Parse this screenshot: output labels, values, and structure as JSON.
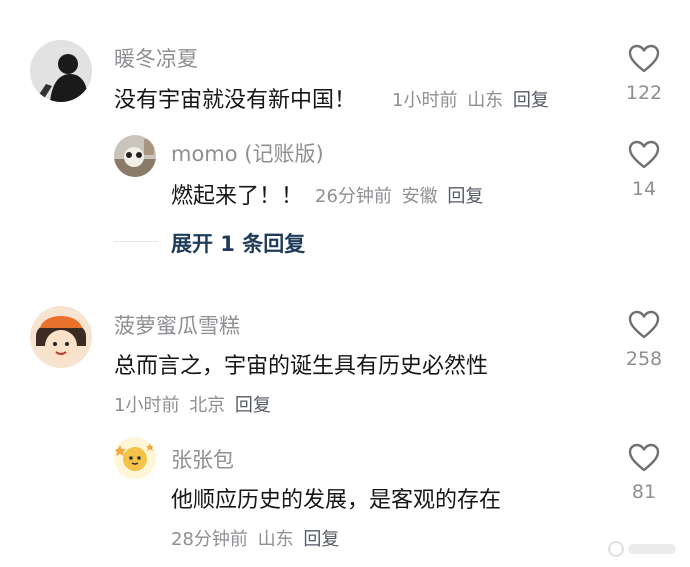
{
  "comments": [
    {
      "username": "暖冬凉夏",
      "text": "没有宇宙就没有新中国！",
      "time": "1小时前",
      "location": "山东",
      "reply_label": "回复",
      "likes": "122",
      "replies": [
        {
          "username": "momo (记账版)",
          "text": "燃起来了！！",
          "time": "26分钟前",
          "location": "安徽",
          "reply_label": "回复",
          "likes": "14"
        }
      ],
      "expand_label": "展开 1 条回复"
    },
    {
      "username": "菠萝蜜瓜雪糕",
      "text": "总而言之，宇宙的诞生具有历史必然性",
      "time": "1小时前",
      "location": "北京",
      "reply_label": "回复",
      "likes": "258",
      "replies": [
        {
          "username": "张张包",
          "text": "他顺应历史的发展，是客观的存在",
          "time": "28分钟前",
          "location": "山东",
          "reply_label": "回复",
          "likes": "81"
        }
      ]
    }
  ],
  "icons": {
    "like": "heart-outline-icon"
  },
  "colors": {
    "username": "#8f8f94",
    "text": "#161616",
    "expand": "#1f3b5a",
    "heart": "#6f6f74"
  }
}
